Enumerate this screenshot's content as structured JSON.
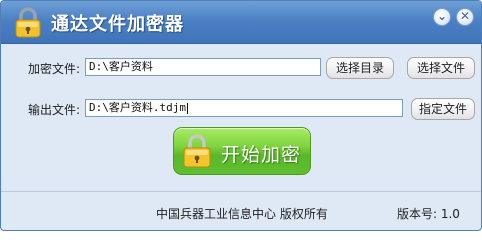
{
  "window": {
    "title": "通达文件加密器",
    "minimize_glyph": "⌄",
    "close_glyph": "✕",
    "icon": "padlock-icon"
  },
  "encrypt_row": {
    "label": "加密文件:",
    "value": "D:\\客户资料",
    "select_dir_label": "选择目录",
    "select_file_label": "选择文件"
  },
  "output_row": {
    "label": "输出文件:",
    "value": "D:\\客户资料.tdjm",
    "specify_file_label": "指定文件"
  },
  "start_button": {
    "label": "开始加密",
    "icon": "padlock-icon"
  },
  "footer": {
    "copyright": "中国兵器工业信息中心 版权所有",
    "version": "版本号: 1.0"
  },
  "colors": {
    "titlebar": "#4b81c4",
    "body": "#dfe9f6",
    "start_button": "#6cc735"
  }
}
